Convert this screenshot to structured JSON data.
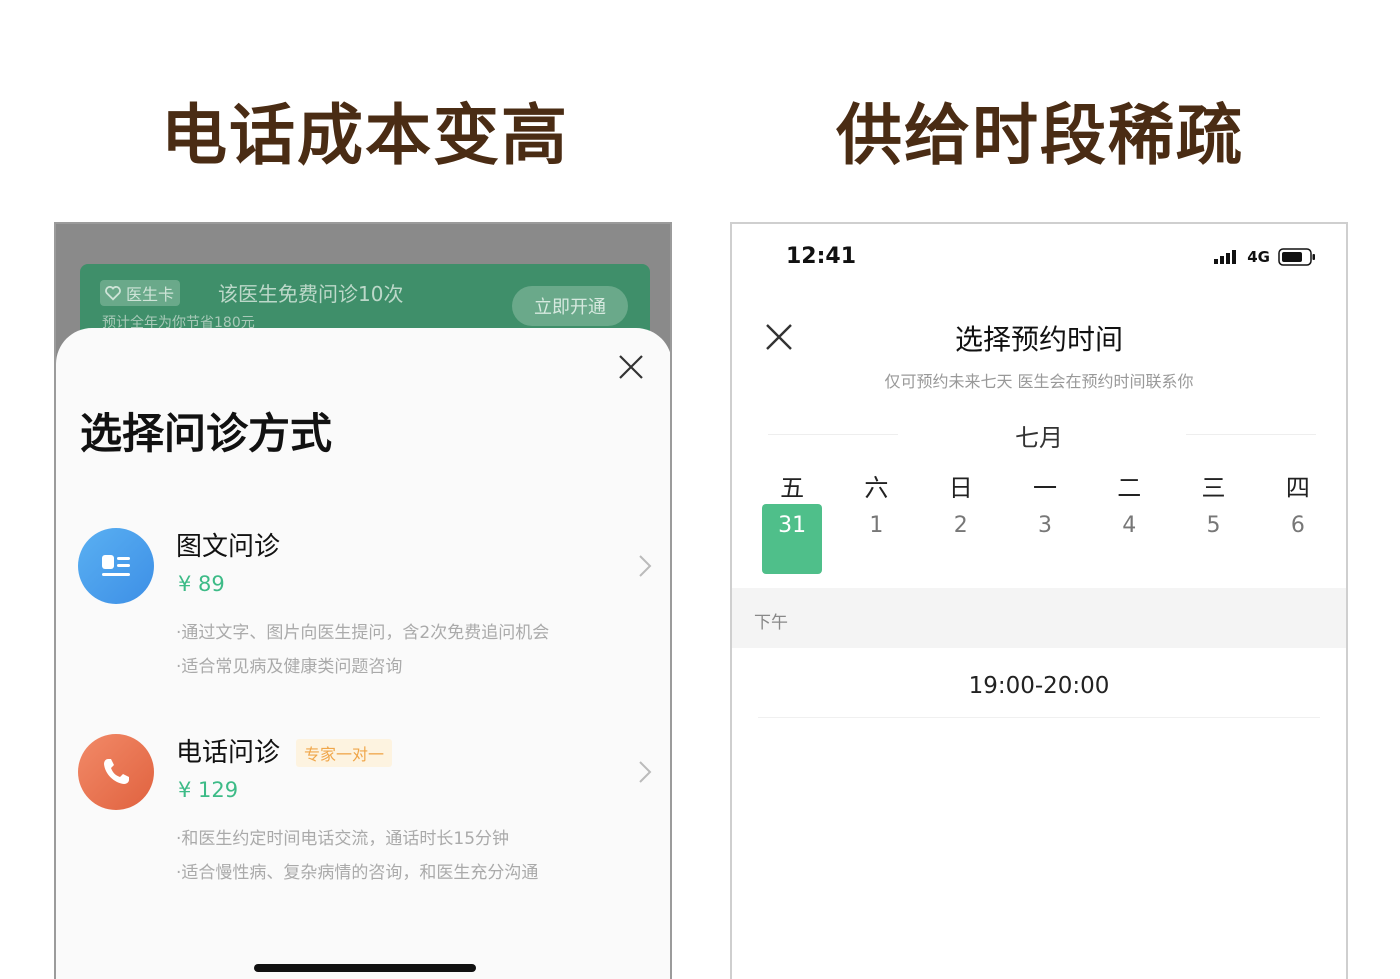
{
  "headings": {
    "left": "电话成本变高",
    "right": "供给时段稀疏"
  },
  "left_screen": {
    "banner": {
      "badge": "医生卡",
      "text": "该医生免费问诊10次",
      "sub": "预计全年为你节省180元",
      "button": "立即开通",
      "icon": "heart-icon"
    },
    "sheet": {
      "title": "选择问诊方式",
      "close_icon": "close-icon",
      "options": [
        {
          "title": "图文问诊",
          "tag": "",
          "price": "¥ 89",
          "desc": [
            "·通过文字、图片向医生提问，含2次免费追问机会",
            "·适合常见病及健康类问题咨询"
          ],
          "icon": "text-consult-icon"
        },
        {
          "title": "电话问诊",
          "tag": "专家一对一",
          "price": "¥ 129",
          "desc": [
            "·和医生约定时间电话交流，通话时长15分钟",
            "·适合慢性病、复杂病情的咨询，和医生充分沟通"
          ],
          "icon": "phone-icon"
        }
      ]
    }
  },
  "right_screen": {
    "status": {
      "time": "12:41",
      "network": "4G"
    },
    "title": "选择预约时间",
    "subtitle": "仅可预约未来七天 医生会在预约时间联系你",
    "month": "七月",
    "days": [
      {
        "weekday": "五",
        "date": "31",
        "selected": true
      },
      {
        "weekday": "六",
        "date": "1",
        "selected": false
      },
      {
        "weekday": "日",
        "date": "2",
        "selected": false
      },
      {
        "weekday": "一",
        "date": "3",
        "selected": false
      },
      {
        "weekday": "二",
        "date": "4",
        "selected": false
      },
      {
        "weekday": "三",
        "date": "5",
        "selected": false
      },
      {
        "weekday": "四",
        "date": "6",
        "selected": false
      }
    ],
    "section": "下午",
    "slots": [
      "19:00-20:00"
    ]
  },
  "colors": {
    "heading": "#4a2c14",
    "accent_green": "#4fbf8a",
    "price_green": "#3dbb87",
    "tag_orange": "#f0a64a"
  }
}
